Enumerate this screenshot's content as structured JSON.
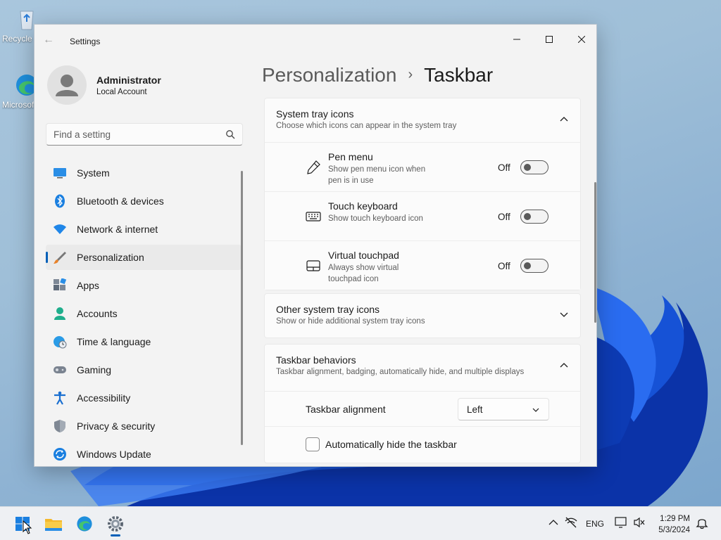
{
  "window": {
    "title": "Settings"
  },
  "desktop": {
    "icons": [
      {
        "label": "Recycle Bin"
      },
      {
        "label": "Microsoft Edge"
      }
    ]
  },
  "profile": {
    "name": "Administrator",
    "account_type": "Local Account"
  },
  "search": {
    "placeholder": "Find a setting"
  },
  "sidebar": {
    "items": [
      {
        "label": "System",
        "icon": "monitor-icon"
      },
      {
        "label": "Bluetooth & devices",
        "icon": "bluetooth-icon"
      },
      {
        "label": "Network & internet",
        "icon": "wifi-icon"
      },
      {
        "label": "Personalization",
        "icon": "paintbrush-icon",
        "active": true
      },
      {
        "label": "Apps",
        "icon": "apps-icon"
      },
      {
        "label": "Accounts",
        "icon": "person-icon"
      },
      {
        "label": "Time & language",
        "icon": "globe-clock-icon"
      },
      {
        "label": "Gaming",
        "icon": "gamepad-icon"
      },
      {
        "label": "Accessibility",
        "icon": "accessibility-icon"
      },
      {
        "label": "Privacy & security",
        "icon": "shield-icon"
      },
      {
        "label": "Windows Update",
        "icon": "update-icon"
      }
    ]
  },
  "breadcrumb": {
    "parent": "Personalization",
    "separator": "›",
    "current": "Taskbar"
  },
  "sections": {
    "system_tray": {
      "title": "System tray icons",
      "description": "Choose which icons can appear in the system tray",
      "expanded": true,
      "items": [
        {
          "title": "Pen menu",
          "description": "Show pen menu icon when pen is in use",
          "state": "Off",
          "icon": "pen-icon"
        },
        {
          "title": "Touch keyboard",
          "description": "Show touch keyboard icon",
          "state": "Off",
          "icon": "keyboard-icon"
        },
        {
          "title": "Virtual touchpad",
          "description": "Always show virtual touchpad icon",
          "state": "Off",
          "icon": "touchpad-icon"
        }
      ]
    },
    "other_tray": {
      "title": "Other system tray icons",
      "description": "Show or hide additional system tray icons",
      "expanded": false
    },
    "behaviors": {
      "title": "Taskbar behaviors",
      "description": "Taskbar alignment, badging, automatically hide, and multiple displays",
      "expanded": true,
      "alignment_label": "Taskbar alignment",
      "alignment_value": "Left",
      "autohide_label": "Automatically hide the taskbar",
      "autohide_checked": false
    }
  },
  "taskbar": {
    "apps": [
      "start-icon",
      "file-explorer-icon",
      "edge-icon",
      "settings-icon"
    ],
    "language": "ENG",
    "time": "1:29 PM",
    "date": "5/3/2024"
  },
  "colors": {
    "accent": "#005fb8",
    "window_bg": "#f3f3f3",
    "card_bg": "#fbfbfb"
  }
}
